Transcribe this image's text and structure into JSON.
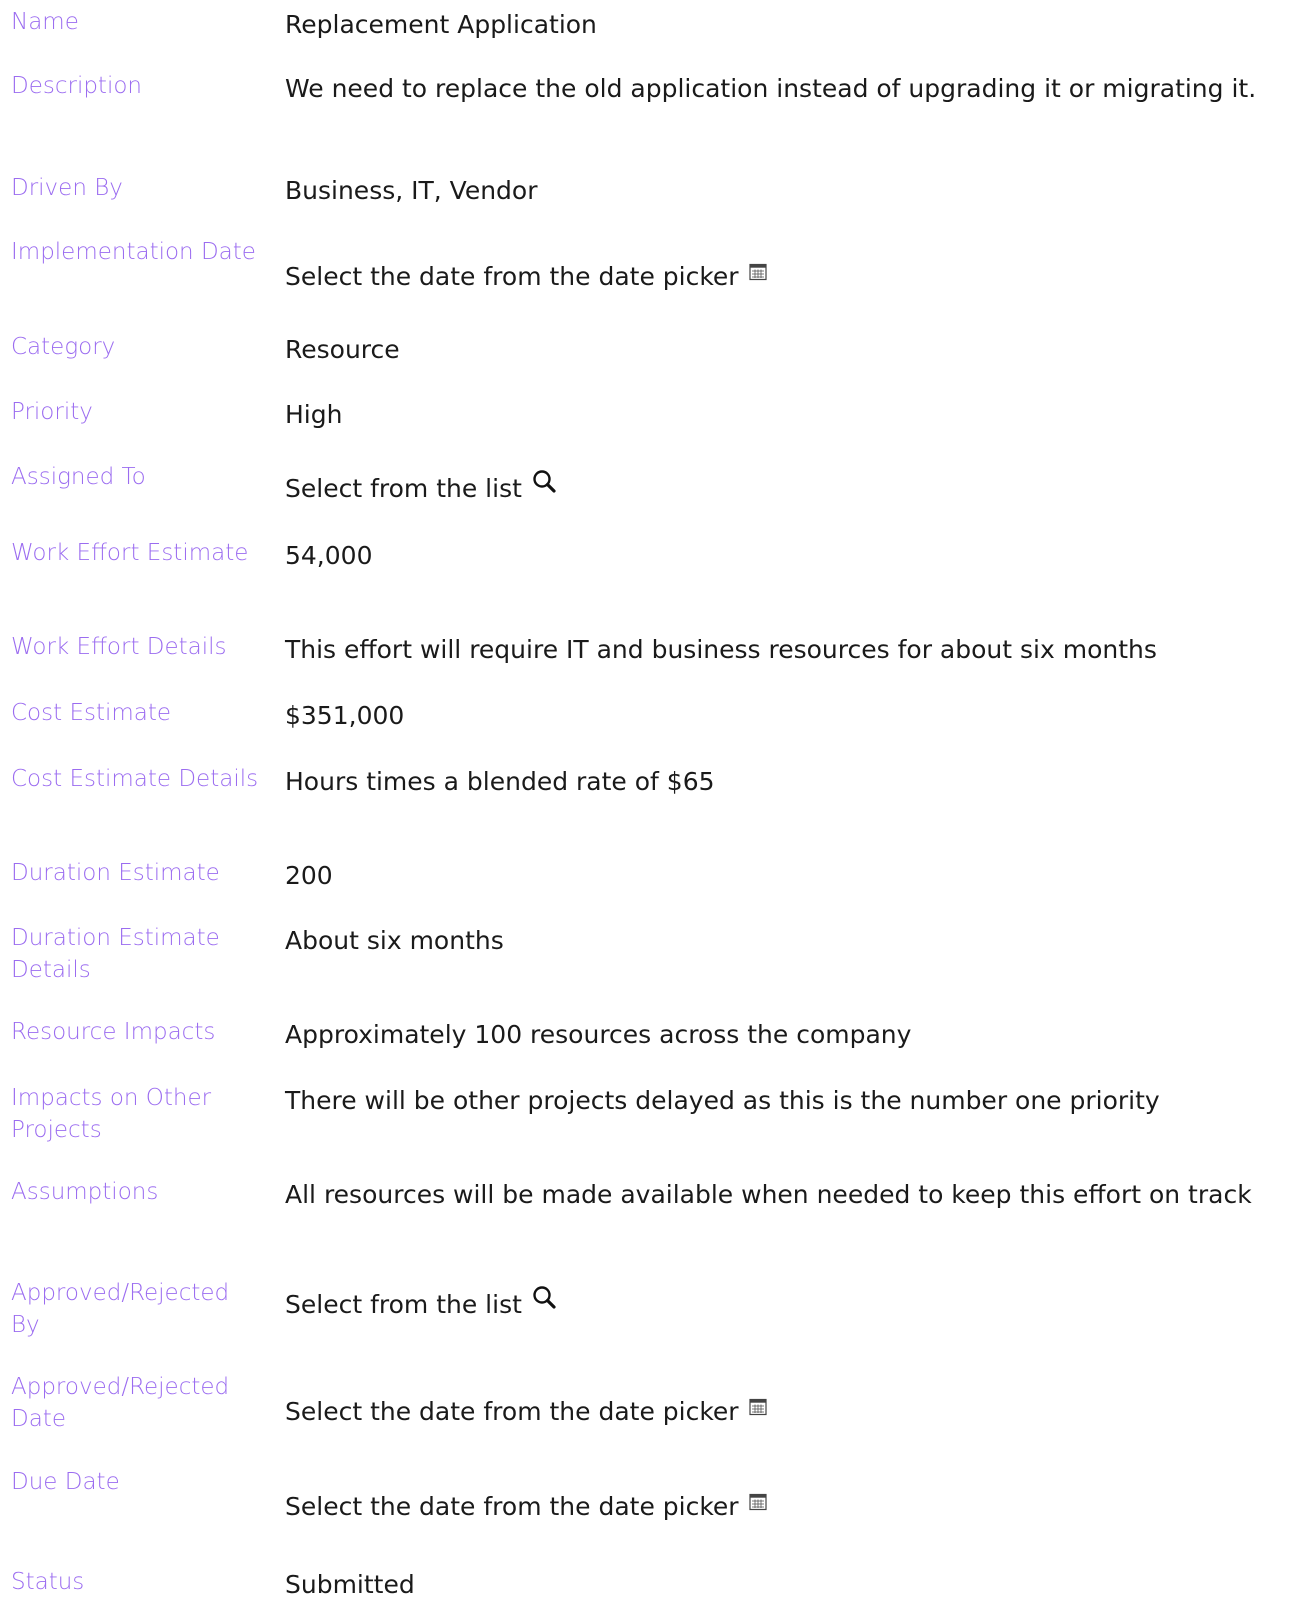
{
  "fields": [
    {
      "label": "Name",
      "value": "Replacement Application"
    },
    {
      "label": "Description",
      "value": "We need to replace the old application instead of upgrading it or migrating it."
    },
    {
      "label": "Driven By",
      "value": "Business, IT, Vendor"
    },
    {
      "label": "Implementation Date",
      "value": "Select the date from the date picker",
      "icon": "calendar-icon"
    },
    {
      "label": "Category",
      "value": "Resource"
    },
    {
      "label": "Priority",
      "value": "High"
    },
    {
      "label": "Assigned To",
      "value": "Select from the list",
      "icon": "search-icon"
    },
    {
      "label": "Work Effort Estimate",
      "value": "54,000"
    },
    {
      "label": "Work Effort Details",
      "value": "This effort will require IT and business resources for about six months"
    },
    {
      "label": "Cost Estimate",
      "value": "$351,000"
    },
    {
      "label": "Cost Estimate Details",
      "value": "Hours times a blended rate of $65"
    },
    {
      "label": "Duration Estimate",
      "value": "200"
    },
    {
      "label": "Duration Estimate Details",
      "value": "About six months"
    },
    {
      "label": "Resource Impacts",
      "value": "Approximately 100 resources across the company"
    },
    {
      "label": "Impacts on Other Projects",
      "value": "There will be other projects delayed as this is the number one priority"
    },
    {
      "label": "Assumptions",
      "value": "All resources will be made available when needed to keep this effort on track"
    },
    {
      "label": "Approved/Rejected By",
      "value": "Select from the list",
      "icon": "search-icon"
    },
    {
      "label": "Approved/Rejected Date",
      "value": "Select the date from the date picker",
      "icon": "calendar-icon"
    },
    {
      "label": "Due Date",
      "value": "Select the date from the date picker",
      "icon": "calendar-icon"
    },
    {
      "label": "Status",
      "value": "Submitted"
    }
  ],
  "colors": {
    "label": "#9b6cf0",
    "value": "#1a1a1a"
  }
}
